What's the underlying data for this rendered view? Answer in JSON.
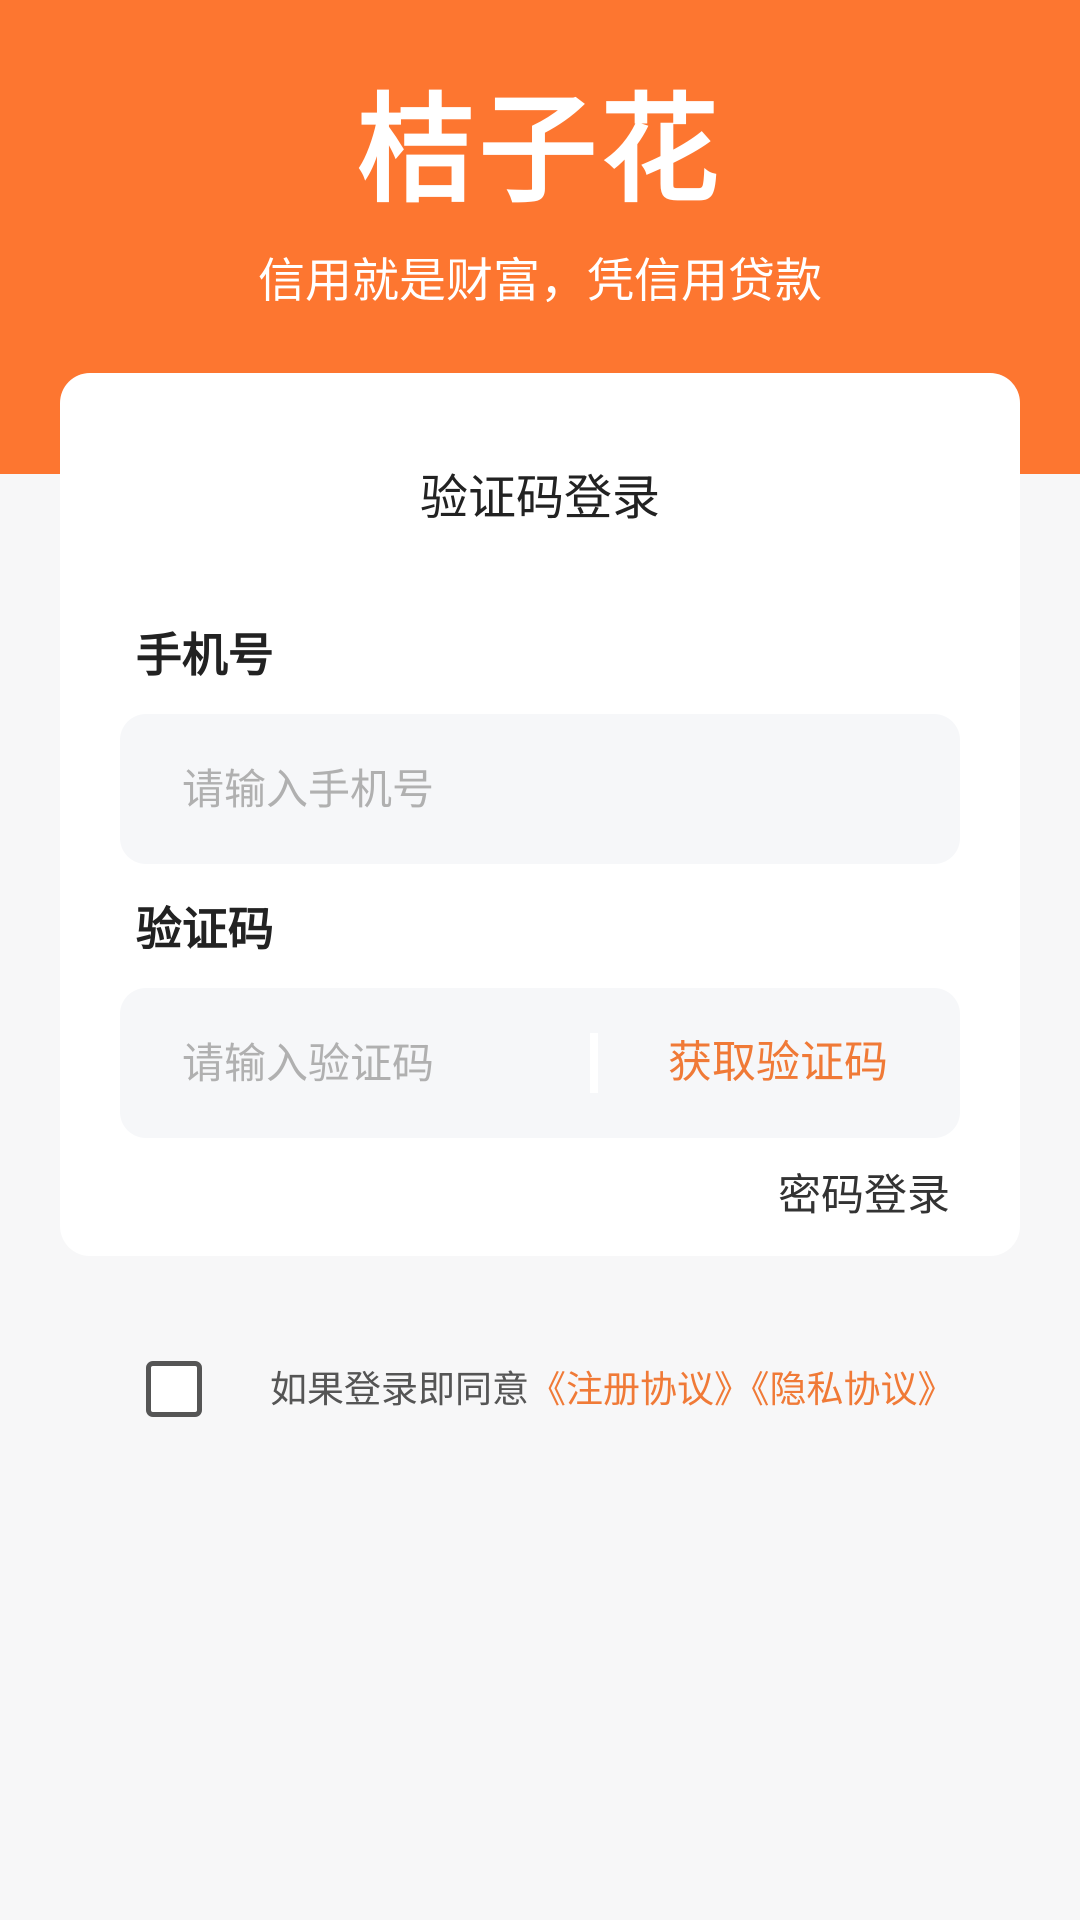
{
  "header": {
    "title": "桔子花",
    "slogan": "信用就是财富，凭信用贷款"
  },
  "login_card": {
    "title": "验证码登录",
    "phone_label": "手机号",
    "phone_placeholder": "请输入手机号",
    "phone_value": "",
    "code_label": "验证码",
    "code_placeholder": "请输入验证码",
    "code_value": "",
    "get_code_button": "获取验证码",
    "password_login_link": "密码登录"
  },
  "agreement": {
    "checked": false,
    "text": "如果登录即同意",
    "register_link": "《注册协议》",
    "privacy_link": "《隐私协议》"
  },
  "colors": {
    "brand": "#fd7630",
    "accent_text": "#f07a37",
    "background": "#f7f7f8"
  }
}
